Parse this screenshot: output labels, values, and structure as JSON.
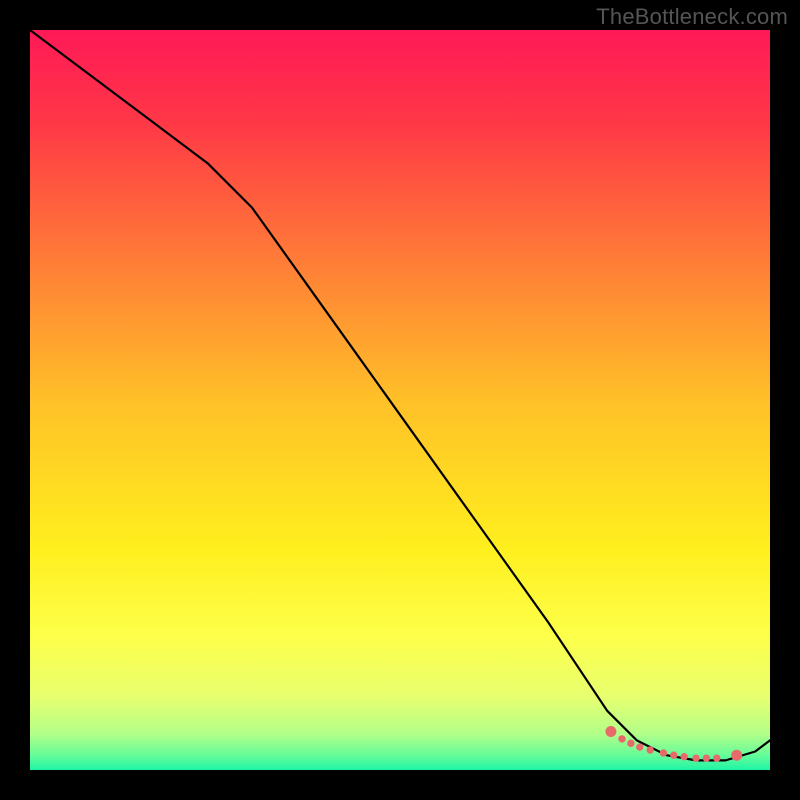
{
  "watermark": "TheBottleneck.com",
  "chart_data": {
    "type": "line",
    "title": "",
    "xlabel": "",
    "ylabel": "",
    "xlim": [
      0,
      100
    ],
    "ylim": [
      0,
      100
    ],
    "background_gradient": {
      "stops": [
        {
          "offset": 0.0,
          "color": "#ff1957"
        },
        {
          "offset": 0.12,
          "color": "#ff3647"
        },
        {
          "offset": 0.3,
          "color": "#ff7838"
        },
        {
          "offset": 0.5,
          "color": "#ffc028"
        },
        {
          "offset": 0.7,
          "color": "#ffef1e"
        },
        {
          "offset": 0.82,
          "color": "#fdff4a"
        },
        {
          "offset": 0.9,
          "color": "#e8ff6f"
        },
        {
          "offset": 0.95,
          "color": "#b4ff88"
        },
        {
          "offset": 0.98,
          "color": "#66fc99"
        },
        {
          "offset": 1.0,
          "color": "#1ef5a6"
        }
      ]
    },
    "series": [
      {
        "name": "curve",
        "color": "#000000",
        "x": [
          0,
          8,
          16,
          24,
          30,
          40,
          50,
          60,
          70,
          78,
          82,
          86,
          90,
          94,
          98,
          100
        ],
        "y": [
          100,
          94,
          88,
          82,
          76,
          62,
          48,
          34,
          20,
          8,
          4,
          2,
          1.3,
          1.3,
          2.5,
          4
        ]
      }
    ],
    "markers": {
      "name": "highlight-points",
      "color": "#e86a6a",
      "stroke": "#e86a6a",
      "radius_large": 5,
      "radius_small": 3.2,
      "points": [
        {
          "x": 78.5,
          "y": 5.2,
          "r": "large"
        },
        {
          "x": 80.0,
          "y": 4.2,
          "r": "small"
        },
        {
          "x": 81.2,
          "y": 3.6,
          "r": "small"
        },
        {
          "x": 82.4,
          "y": 3.1,
          "r": "small"
        },
        {
          "x": 83.8,
          "y": 2.7,
          "r": "small"
        },
        {
          "x": 85.6,
          "y": 2.3,
          "r": "small"
        },
        {
          "x": 87.0,
          "y": 2.0,
          "r": "small"
        },
        {
          "x": 88.4,
          "y": 1.8,
          "r": "small"
        },
        {
          "x": 90.0,
          "y": 1.6,
          "r": "small"
        },
        {
          "x": 91.4,
          "y": 1.6,
          "r": "small"
        },
        {
          "x": 92.8,
          "y": 1.6,
          "r": "small"
        },
        {
          "x": 95.5,
          "y": 2.0,
          "r": "large"
        }
      ]
    }
  }
}
